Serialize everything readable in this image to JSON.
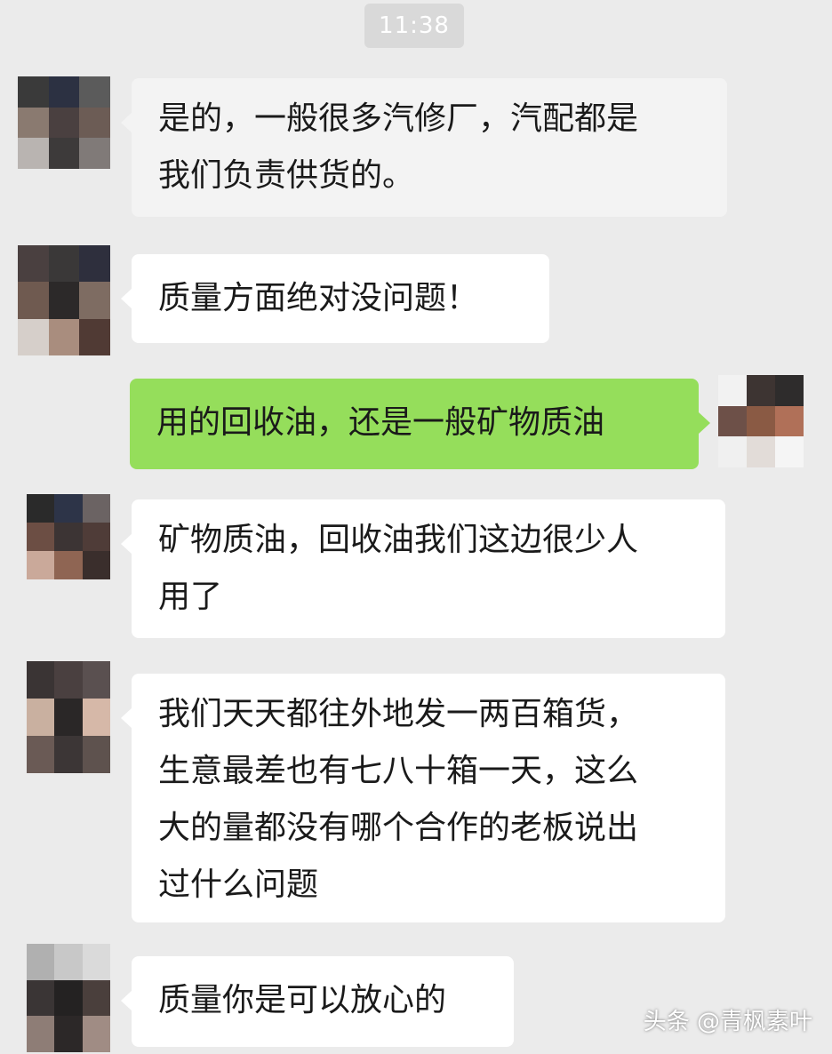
{
  "status": {
    "time": "11:38"
  },
  "messages": [
    {
      "side": "left",
      "text": "是的，一般很多汽修厂，汽配都是\n我们负责供货的。"
    },
    {
      "side": "left",
      "text": "质量方面绝对没问题！"
    },
    {
      "side": "right",
      "text": "用的回收油，还是一般矿物质油"
    },
    {
      "side": "left",
      "text": "矿物质油，回收油我们这边很少人\n用了"
    },
    {
      "side": "left",
      "text": "我们天天都往外地发一两百箱货，\n生意最差也有七八十箱一天，这么\n大的量都没有哪个合作的老板说出\n过什么问题"
    },
    {
      "side": "left",
      "text": "质量你是可以放心的"
    }
  ],
  "avatars": {
    "contact_1": [
      "#3a3a3a",
      "#2c3142",
      "#5b5b5b",
      "#8a7a70",
      "#4a4040",
      "#6c5c55",
      "#b9b4b1",
      "#3d3a3a",
      "#807a78"
    ],
    "contact_2": [
      "#4a4040",
      "#3a3838",
      "#2e2f3d",
      "#6f5a50",
      "#2c2929",
      "#7e6c62",
      "#d6cfca",
      "#a98d7e",
      "#503a34"
    ],
    "self": [
      "#f2f2f2",
      "#3d3432",
      "#2e2c2c",
      "#6d5048",
      "#8a5a44",
      "#b07058",
      "#f0f0f0",
      "#e2dcd8",
      "#f5f5f5"
    ],
    "contact_3": [
      "#2a2a2a",
      "#2d3448",
      "#6b6363",
      "#6c4e44",
      "#3c3434",
      "#4f3c38",
      "#caa99a",
      "#8f6553",
      "#3a2e2c"
    ],
    "contact_4": [
      "#3a3434",
      "#4a4040",
      "#5a5050",
      "#c9b0a0",
      "#2a2727",
      "#d6b8a8",
      "#6a5a55",
      "#3c3636",
      "#5e524e"
    ],
    "contact_5": [
      "#b0b0b0",
      "#c8c8c8",
      "#dadada",
      "#3a3535",
      "#242222",
      "#4a3f3c",
      "#8e7d76",
      "#2c2828",
      "#a08c84"
    ]
  },
  "watermark": "头条 @青枫素叶"
}
